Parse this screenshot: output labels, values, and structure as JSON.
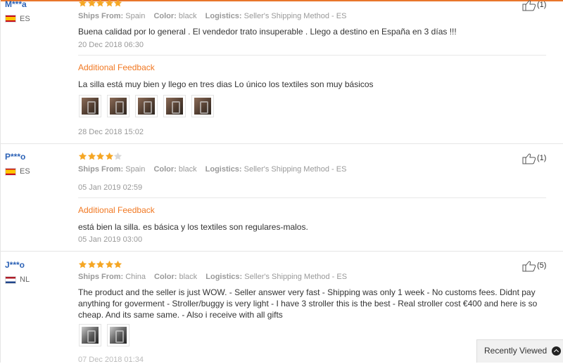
{
  "labels": {
    "ships_from": "Ships From:",
    "color": "Color:",
    "logistics": "Logistics:",
    "additional_feedback": "Additional Feedback"
  },
  "reviews": [
    {
      "buyer": "M***a",
      "country": "ES",
      "flag": "spain-flag-icon",
      "rating": 5,
      "ships_from": "Spain",
      "color": "black",
      "logistics": "Seller's Shipping Method - ES",
      "text": "Buena calidad por lo general . El vendedor trato insuperable . Llego a destino en España en 3 días !!!",
      "date": "20 Dec 2018 06:30",
      "likes": "(1)",
      "additional_feedback": {
        "text": "La silla está muy bien y llego en tres dias Lo único los textiles son muy básicos",
        "photos": 5,
        "date": "28 Dec 2018 15:02"
      }
    },
    {
      "buyer": "P***o",
      "country": "ES",
      "flag": "spain-flag-icon",
      "rating": 4,
      "ships_from": "Spain",
      "color": "black",
      "logistics": "Seller's Shipping Method - ES",
      "date": "05 Jan 2019 02:59",
      "likes": "(1)",
      "additional_feedback": {
        "text": "está bien la silla. es básica y los textiles son regulares-malos.",
        "date": "05 Jan 2019 03:00"
      }
    },
    {
      "buyer": "J***o",
      "country": "NL",
      "flag": "netherlands-flag-icon",
      "rating": 5,
      "ships_from": "China",
      "color": "black",
      "logistics": "Seller's Shipping Method - ES",
      "text": "The product and the seller is just WOW. - Seller answer very fast - Shipping was only 1 week - No customs fees. Didnt pay anything for goverment - Stroller/buggy is very light - I have 3 stroller this is the best - Real stroller cost €400 and here is so cheap. And its same same. - Also i receive with all gifts",
      "photos": 2,
      "date_partial": "07 Dec 2018 01:34",
      "likes": "(5)"
    }
  ],
  "recently_viewed": {
    "label": "Recently Viewed",
    "icon": "chevron-up-circle-icon"
  },
  "colors": {
    "star": "#f5a623",
    "star_empty": "#d8d8d8",
    "accent_orange": "#f17822",
    "buyer_blue": "#2c62b6"
  }
}
